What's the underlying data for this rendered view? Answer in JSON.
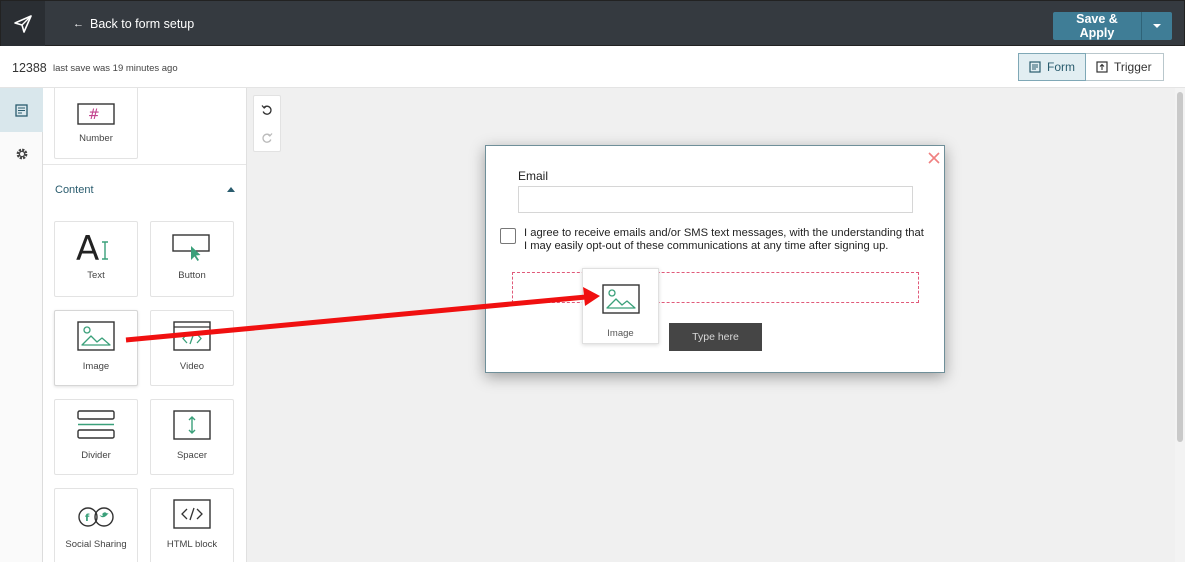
{
  "topbar": {
    "back_arrow": "←",
    "back_label": "Back to form setup",
    "save_label": "Save & Apply"
  },
  "subbar": {
    "form_id": "12388",
    "save_status": "last save was 19 minutes ago",
    "modes": [
      {
        "label": "Form",
        "active": true
      },
      {
        "label": "Trigger",
        "active": false
      }
    ]
  },
  "panel": {
    "top_tiles": [
      {
        "label": "Number",
        "icon": "hash-input-icon"
      }
    ],
    "content_section": {
      "title": "Content",
      "expanded": true,
      "tiles": [
        {
          "label": "Text",
          "icon": "text-icon"
        },
        {
          "label": "Button",
          "icon": "button-icon"
        },
        {
          "label": "Image",
          "icon": "image-icon"
        },
        {
          "label": "Video",
          "icon": "video-icon"
        },
        {
          "label": "Divider",
          "icon": "divider-icon"
        },
        {
          "label": "Spacer",
          "icon": "spacer-icon"
        },
        {
          "label": "Social Sharing",
          "icon": "social-sharing-icon"
        },
        {
          "label": "HTML block",
          "icon": "html-block-icon"
        }
      ]
    }
  },
  "popup": {
    "email_label": "Email",
    "email_value": "",
    "consent_text": "I agree to receive emails and/or SMS text messages, with the understanding that I may easily opt-out of these communications at any time after signing up.",
    "consent_checked": false,
    "submit_label": "Type here"
  },
  "drag_ghost": {
    "label": "Image"
  },
  "colors": {
    "topbar_bg": "#353a40",
    "accent": "#3f7d96",
    "icon_green": "#3aa07a",
    "annotation_arrow": "#f01010"
  }
}
